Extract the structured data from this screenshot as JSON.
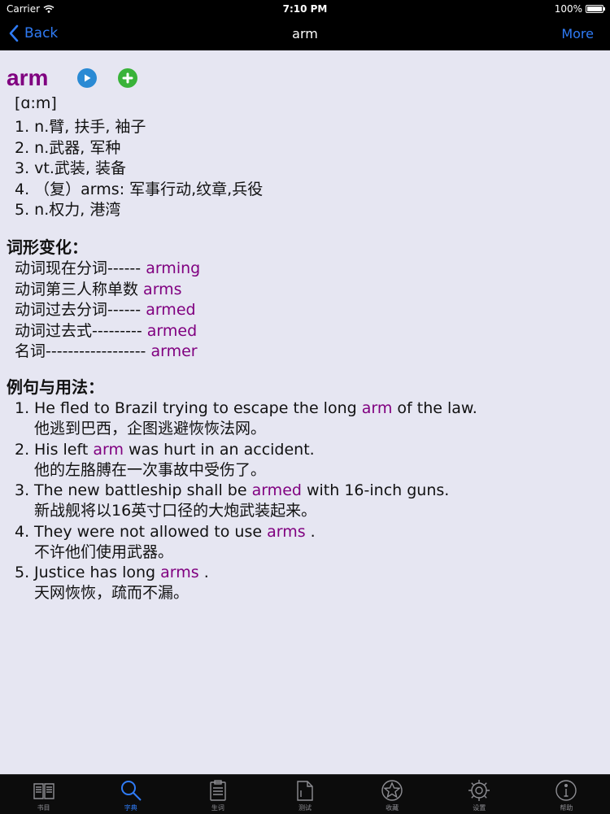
{
  "status_bar": {
    "carrier": "Carrier",
    "time": "7:10 PM",
    "battery": "100%"
  },
  "nav": {
    "back_label": "Back",
    "title": "arm",
    "more_label": "More"
  },
  "entry": {
    "headword": "arm",
    "phonetic": "[ɑ:m]",
    "definitions": [
      "1. n.臂, 扶手, 袖子",
      "2. n.武器, 军种",
      "3. vt.武装, 装备",
      "4. （复）arms: 军事行动,纹章,兵役",
      "5. n.权力, 港湾"
    ]
  },
  "forms_section": {
    "title": "词形变化：",
    "items": [
      {
        "label": "动词现在分词------ ",
        "value": "arming"
      },
      {
        "label": "动词第三人称单数 ",
        "value": "arms"
      },
      {
        "label": "动词过去分词------ ",
        "value": "armed"
      },
      {
        "label": "动词过去式--------- ",
        "value": "armed"
      },
      {
        "label": "名词------------------ ",
        "value": "armer"
      }
    ]
  },
  "examples_section": {
    "title": "例句与用法：",
    "items": [
      {
        "num": "1.",
        "pre": "He fled to Brazil trying to escape the long ",
        "word": "arm",
        "post": " of the law.",
        "zh": "他逃到巴西，企图逃避恢恢法网。"
      },
      {
        "num": "2.",
        "pre": "His left ",
        "word": "arm",
        "post": " was hurt in an accident.",
        "zh": "他的左胳膊在一次事故中受伤了。"
      },
      {
        "num": "3.",
        "pre": "The new battleship shall be ",
        "word": "armed",
        "post": " with 16-inch guns.",
        "zh": "新战舰将以16英寸口径的大炮武装起来。"
      },
      {
        "num": "4.",
        "pre": "They were not allowed to use ",
        "word": "arms",
        "post": " .",
        "zh": "不许他们使用武器。"
      },
      {
        "num": "5.",
        "pre": "Justice has long ",
        "word": "arms",
        "post": " .",
        "zh": "天网恢恢，疏而不漏。"
      }
    ]
  },
  "tabs": [
    {
      "label": "书目",
      "icon": "book-icon"
    },
    {
      "label": "字典",
      "icon": "search-icon"
    },
    {
      "label": "生词",
      "icon": "clipboard-icon"
    },
    {
      "label": "测试",
      "icon": "test-icon"
    },
    {
      "label": "收藏",
      "icon": "star-icon"
    },
    {
      "label": "设置",
      "icon": "gear-icon"
    },
    {
      "label": "帮助",
      "icon": "info-icon"
    }
  ],
  "colors": {
    "accent": "#2f7bf5",
    "keyword": "#800080",
    "background": "#e6e6f2"
  }
}
